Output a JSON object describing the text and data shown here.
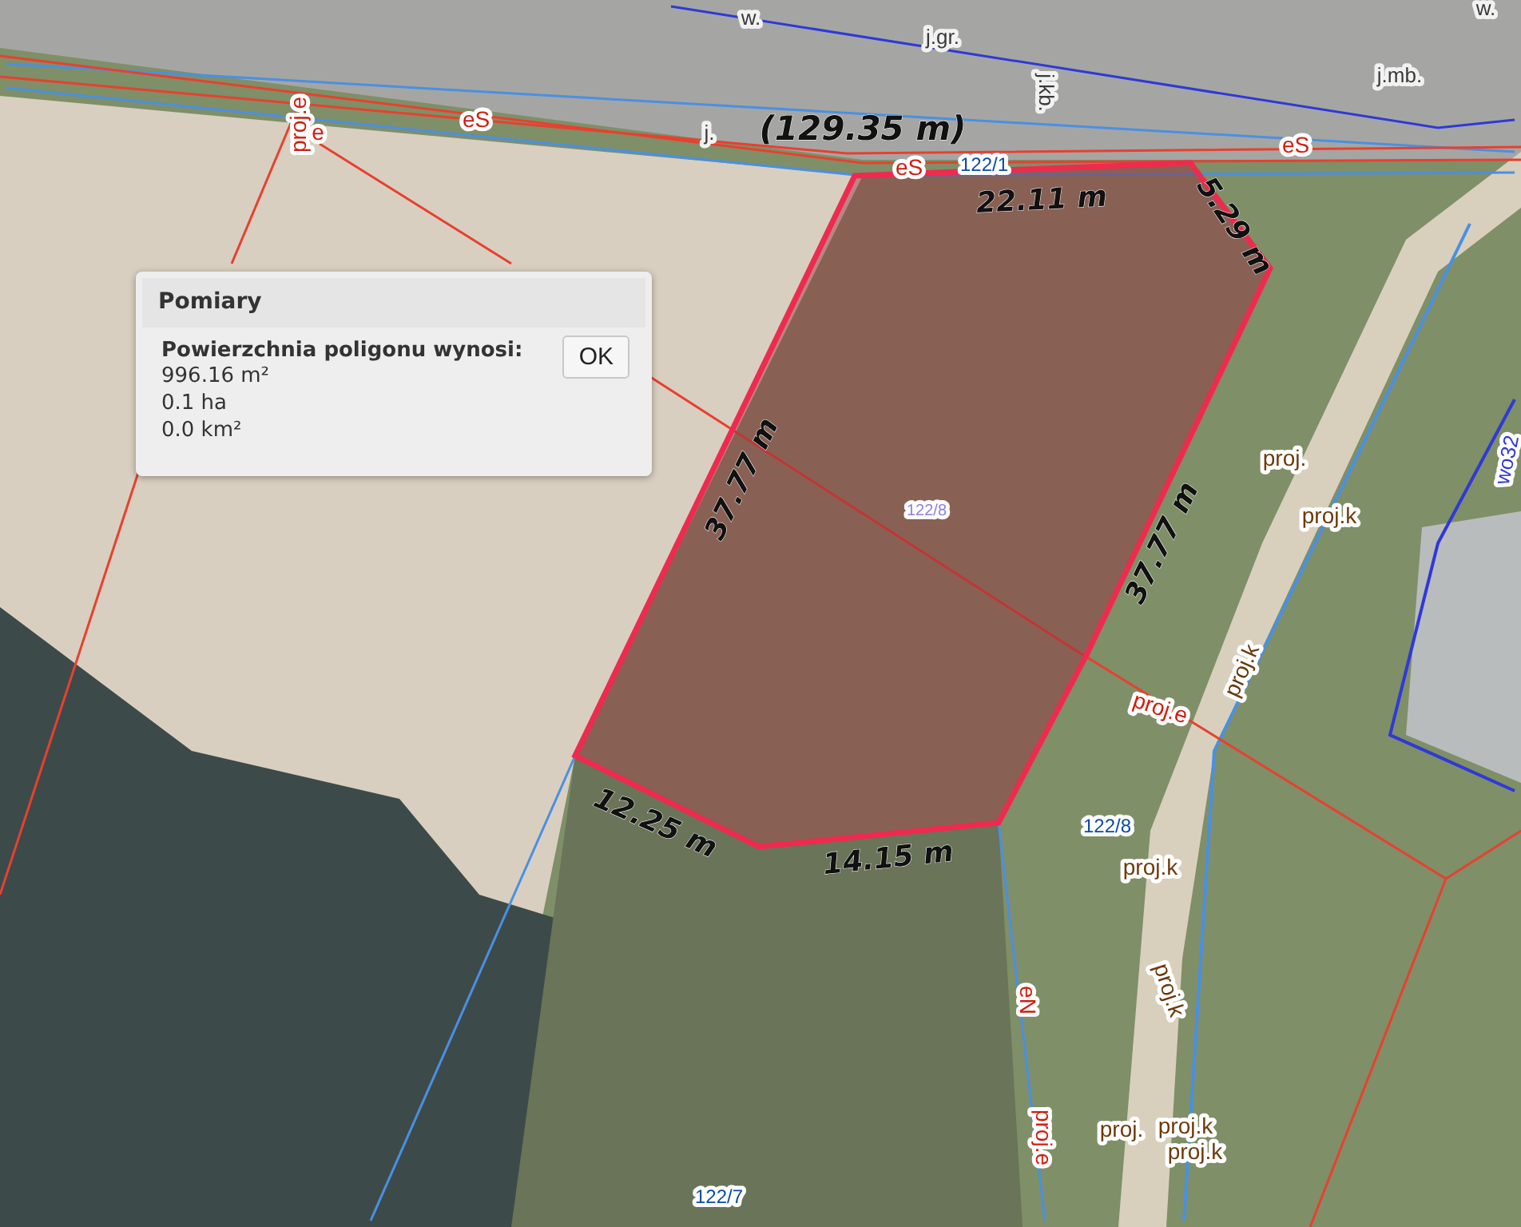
{
  "measurement": {
    "total": "(129.35 m)",
    "segments": [
      "22.11 m",
      "5.29 m",
      "37.77 m",
      "14.15 m",
      "12.25 m",
      "37.77 m"
    ]
  },
  "map_labels": [
    {
      "text": "w.",
      "kind": "street"
    },
    {
      "text": "j.gr.",
      "kind": "street"
    },
    {
      "text": "j.kb.",
      "kind": "street"
    },
    {
      "text": "j.mb.",
      "kind": "street"
    },
    {
      "text": "w.",
      "kind": "street"
    },
    {
      "text": "proj.e",
      "kind": "utility"
    },
    {
      "text": "e",
      "kind": "utility"
    },
    {
      "text": "eS",
      "kind": "utility"
    },
    {
      "text": "j.",
      "kind": "street"
    },
    {
      "text": "eS",
      "kind": "utility"
    },
    {
      "text": "eS",
      "kind": "utility"
    },
    {
      "text": "122/1",
      "kind": "parcel"
    },
    {
      "text": "122/8",
      "kind": "parcel_inner"
    },
    {
      "text": "proj.",
      "kind": "plan"
    },
    {
      "text": "proj.k",
      "kind": "plan"
    },
    {
      "text": "wo32",
      "kind": "building"
    },
    {
      "text": "proj.k",
      "kind": "plan"
    },
    {
      "text": "proj.e",
      "kind": "utility"
    },
    {
      "text": "122/8",
      "kind": "parcel"
    },
    {
      "text": "proj.k",
      "kind": "plan"
    },
    {
      "text": "proj.k",
      "kind": "plan"
    },
    {
      "text": "eN",
      "kind": "utility"
    },
    {
      "text": "proj.",
      "kind": "plan"
    },
    {
      "text": "proj.k",
      "kind": "plan"
    },
    {
      "text": "proj.k",
      "kind": "plan"
    },
    {
      "text": "proj.e",
      "kind": "utility"
    },
    {
      "text": "122/7",
      "kind": "parcel"
    }
  ],
  "dialog": {
    "title": "Pomiary",
    "heading": "Powierzchnia poligonu wynosi:",
    "lines": [
      "996.16 m²",
      "0.1 ha",
      "0.0 km²"
    ],
    "button": "OK"
  }
}
